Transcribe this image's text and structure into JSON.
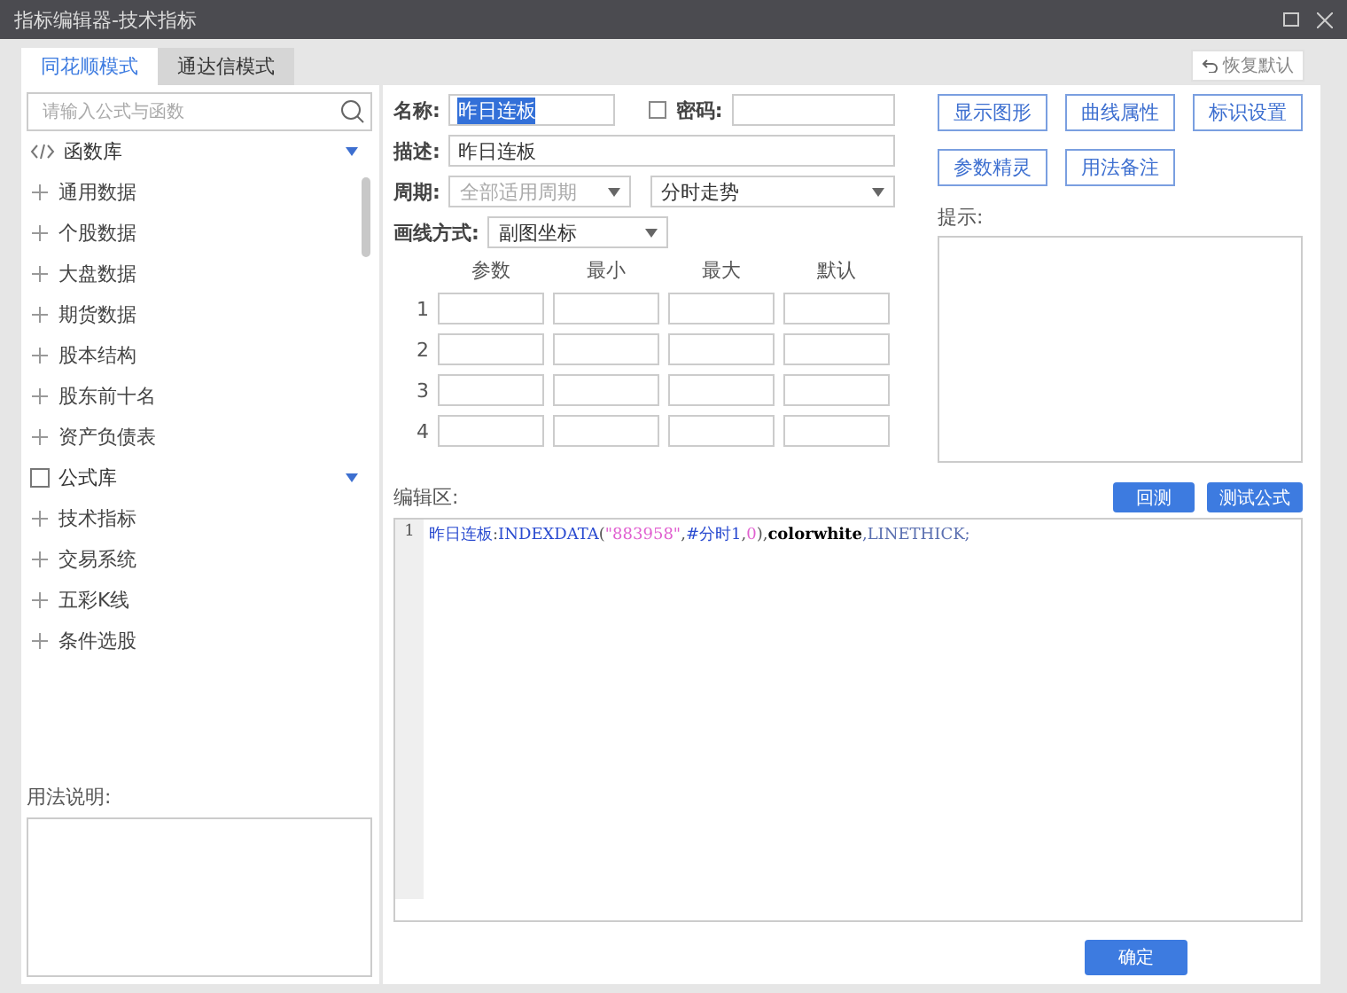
{
  "window": {
    "title": "指标编辑器-技术指标"
  },
  "tabs": [
    {
      "label": "同花顺模式",
      "selected": true
    },
    {
      "label": "通达信模式",
      "selected": false
    }
  ],
  "restore_button": {
    "label": "恢复默认"
  },
  "search": {
    "placeholder": "请输入公式与函数"
  },
  "libraries": [
    {
      "label": "函数库",
      "kind": "code",
      "expanded": true,
      "children": [
        {
          "label": "通用数据",
          "expanded": false
        },
        {
          "label": "个股数据",
          "expanded": false
        },
        {
          "label": "大盘数据",
          "expanded": false
        },
        {
          "label": "期货数据",
          "expanded": false
        },
        {
          "label": "股本结构",
          "expanded": false
        },
        {
          "label": "股东前十名",
          "expanded": false
        },
        {
          "label": "资产负债表",
          "expanded": false
        }
      ]
    },
    {
      "label": "公式库",
      "kind": "box",
      "expanded": true,
      "children": [
        {
          "label": "技术指标",
          "expanded": false
        },
        {
          "label": "交易系统",
          "expanded": false
        },
        {
          "label": "五彩K线",
          "expanded": false
        },
        {
          "label": "条件选股",
          "expanded": false
        }
      ]
    }
  ],
  "usage_label": "用法说明:",
  "form": {
    "name_label": "名称:",
    "name_value": "昨日连板",
    "name_highlighted": true,
    "password_label": "密码:",
    "password_checked": false,
    "desc_label": "描述:",
    "desc_value": "昨日连板",
    "period_label": "周期:",
    "period_value": "全部适用周期",
    "period_disabled": true,
    "period2_value": "分时走势",
    "draw_label": "画线方式:",
    "draw_value": "副图坐标"
  },
  "params": {
    "columns": [
      "参数",
      "最小",
      "最大",
      "默认"
    ],
    "rows": [
      "1",
      "2",
      "3",
      "4"
    ]
  },
  "side_buttons": [
    [
      "显示图形",
      "曲线属性",
      "标识设置"
    ],
    [
      "参数精灵",
      "用法备注"
    ]
  ],
  "hint_label": "提示:",
  "editor_label": "编辑区:",
  "editor_buttons": [
    "回测",
    "测试公式"
  ],
  "code_lines": [
    {
      "number": "1",
      "tokens": [
        {
          "text": "昨日连板",
          "kind": "ident"
        },
        {
          "text": ":",
          "kind": "punct"
        },
        {
          "text": "INDEXDATA",
          "kind": "func"
        },
        {
          "text": "(",
          "kind": "punct"
        },
        {
          "text": "\"883958\"",
          "kind": "string"
        },
        {
          "text": ",",
          "kind": "punct"
        },
        {
          "text": "#分时1",
          "kind": "ident"
        },
        {
          "text": ",",
          "kind": "punct"
        },
        {
          "text": "0",
          "kind": "number"
        },
        {
          "text": "),",
          "kind": "punct"
        },
        {
          "text": "colorwhite",
          "kind": "keyword"
        },
        {
          "text": ",LINETHICK;",
          "kind": "const"
        }
      ]
    }
  ],
  "ok_button": "确定"
}
